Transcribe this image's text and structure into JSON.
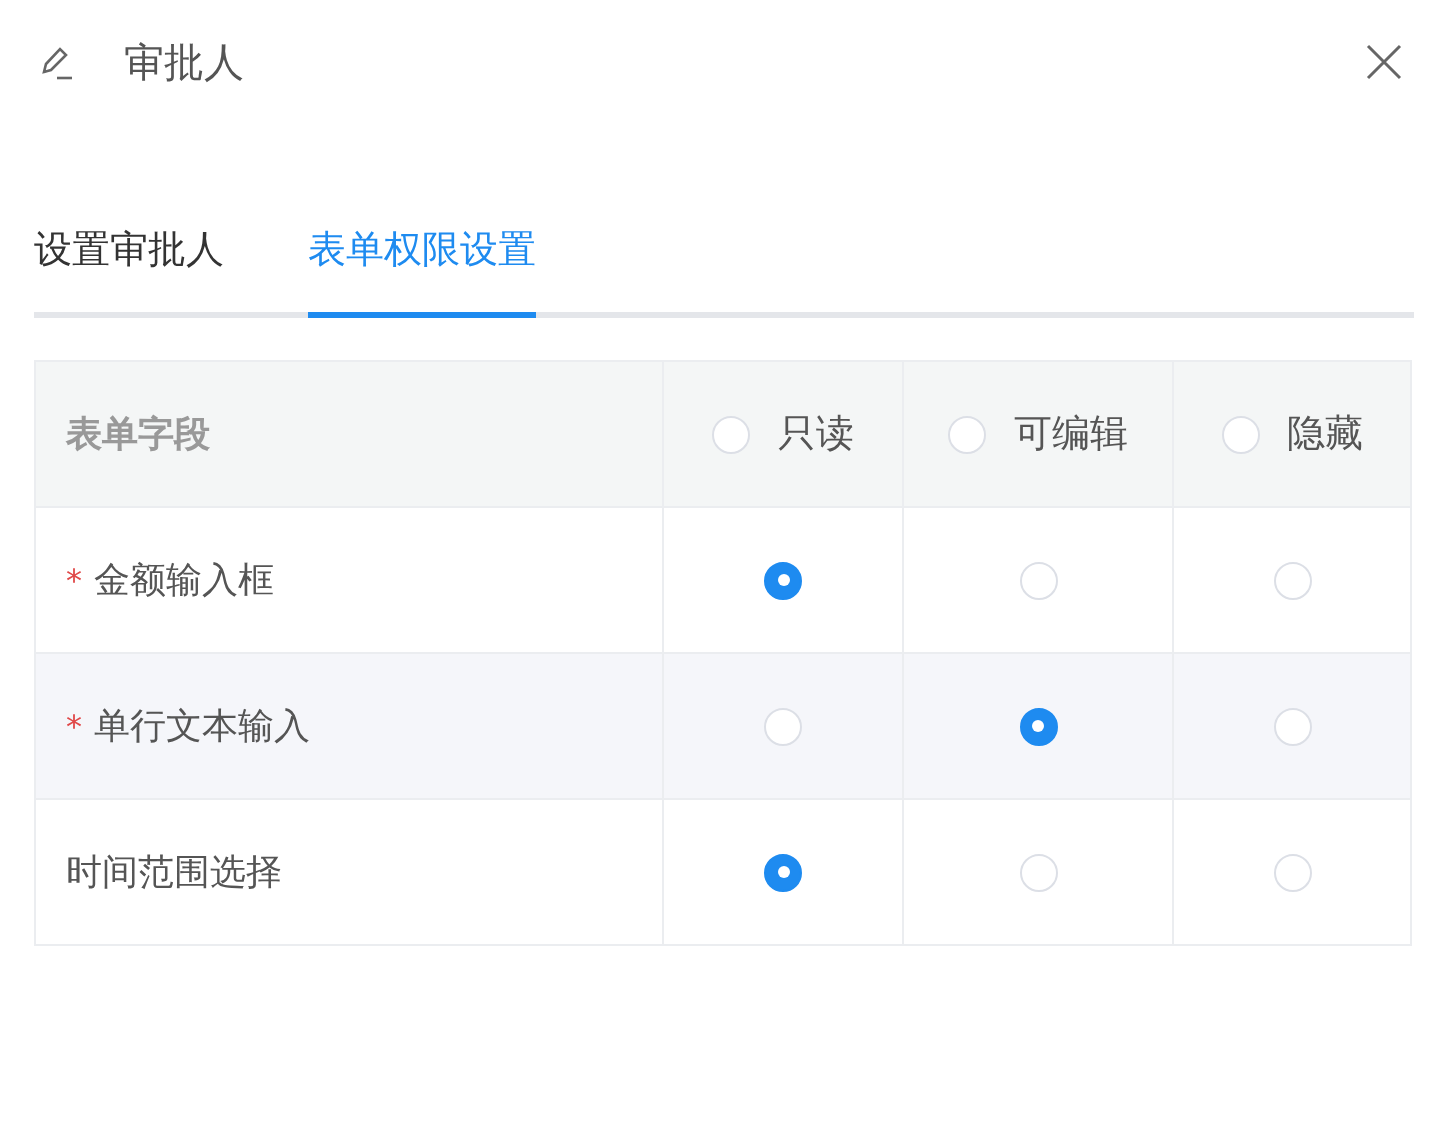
{
  "dialog": {
    "title": "审批人"
  },
  "tabs": [
    {
      "label": "设置审批人",
      "selected": false
    },
    {
      "label": "表单权限设置",
      "selected": true
    }
  ],
  "table": {
    "columns": [
      {
        "label": "表单字段"
      },
      {
        "label": "只读",
        "selected": false
      },
      {
        "label": "可编辑",
        "selected": false
      },
      {
        "label": "隐藏",
        "selected": false
      }
    ],
    "rows": [
      {
        "marker": "*",
        "field": "金额输入框",
        "options": [
          {
            "selected": true
          },
          {
            "selected": false
          },
          {
            "selected": false
          }
        ]
      },
      {
        "marker": "*",
        "field": "单行文本输入",
        "options": [
          {
            "selected": false
          },
          {
            "selected": true
          },
          {
            "selected": false
          }
        ]
      },
      {
        "field": "时间范围选择",
        "options": [
          {
            "selected": true
          },
          {
            "selected": false
          },
          {
            "selected": false
          }
        ]
      }
    ]
  }
}
